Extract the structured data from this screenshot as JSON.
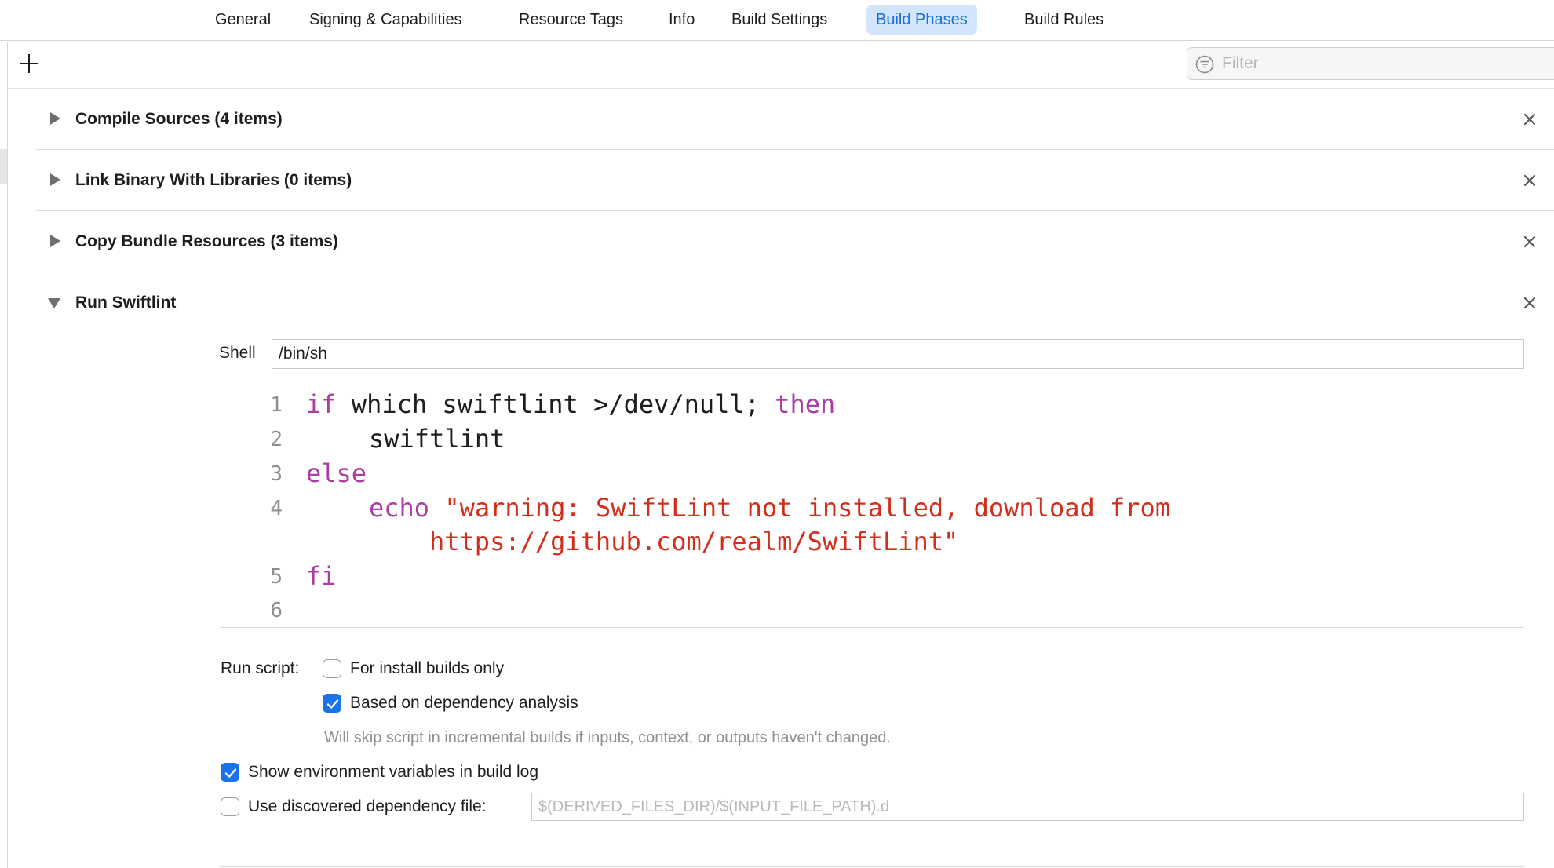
{
  "tabs": [
    {
      "label": "General",
      "active": false
    },
    {
      "label": "Signing & Capabilities",
      "active": false
    },
    {
      "label": "Resource Tags",
      "active": false
    },
    {
      "label": "Info",
      "active": false
    },
    {
      "label": "Build Settings",
      "active": false
    },
    {
      "label": "Build Phases",
      "active": true
    },
    {
      "label": "Build Rules",
      "active": false
    }
  ],
  "toolbar": {
    "add_icon": "plus-icon",
    "filter_icon": "filter-icon",
    "filter_placeholder": "Filter"
  },
  "phases": [
    {
      "title": "Compile Sources (4 items)",
      "expanded": false
    },
    {
      "title": "Link Binary With Libraries (0 items)",
      "expanded": false
    },
    {
      "title": "Copy Bundle Resources (3 items)",
      "expanded": false
    },
    {
      "title": "Run Swiftlint",
      "expanded": true
    }
  ],
  "run_script": {
    "shell_label": "Shell",
    "shell_value": "/bin/sh",
    "line_numbers": [
      "1",
      "2",
      "3",
      "4",
      "5",
      "6"
    ],
    "code": {
      "l1_kw_if": "if",
      "l1_text": " which swiftlint >/dev/null; ",
      "l1_kw_then": "then",
      "l2_text": "swiftlint",
      "l3_kw_else": "else",
      "l4_kw_echo": "echo",
      "l4_str": "\"warning: SwiftLint not installed, download from",
      "l4_cont_str": "https://github.com/realm/SwiftLint\"",
      "l5_kw_fi": "fi"
    },
    "run_script_label": "Run script:",
    "install_builds_label": "For install builds only",
    "install_builds_checked": false,
    "dependency_analysis_label": "Based on dependency analysis",
    "dependency_analysis_checked": true,
    "dependency_hint": "Will skip script in incremental builds if inputs, context, or outputs haven't changed.",
    "show_env_label": "Show environment variables in build log",
    "show_env_checked": true,
    "discovered_dep_label": "Use discovered dependency file:",
    "discovered_dep_checked": false,
    "discovered_dep_placeholder": "$(DERIVED_FILES_DIR)/$(INPUT_FILE_PATH).d"
  },
  "colors": {
    "accent": "#1a73e8",
    "active_tab_bg": "#d3e5fb",
    "keyword": "#ad3da4",
    "string": "#d12f1b"
  }
}
